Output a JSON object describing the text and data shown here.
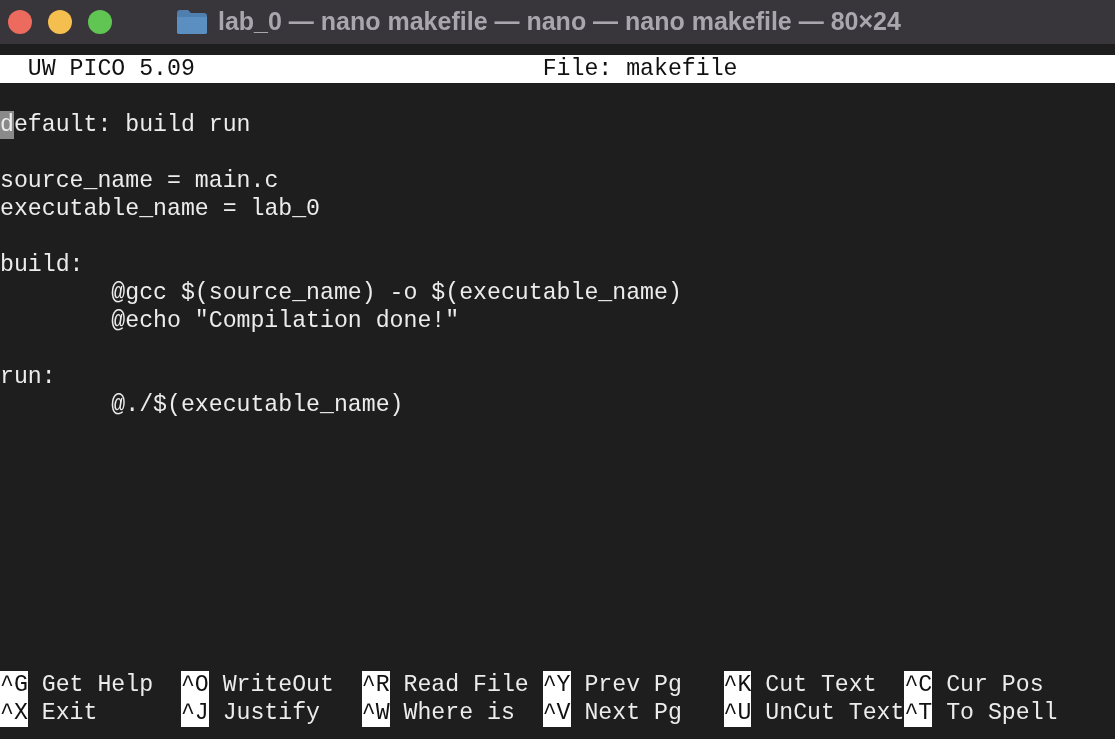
{
  "window": {
    "title": "lab_0 — nano makefile — nano — nano makefile — 80×24"
  },
  "header": {
    "app": "UW PICO 5.09",
    "file": "File: makefile"
  },
  "lines": [
    {
      "kind": "blank"
    },
    {
      "kind": "code",
      "text": "default: build run",
      "indented": false,
      "cursor": true
    },
    {
      "kind": "blank"
    },
    {
      "kind": "code",
      "text": "source_name = main.c",
      "indented": false,
      "cursor": false
    },
    {
      "kind": "code",
      "text": "executable_name = lab_0",
      "indented": false,
      "cursor": false
    },
    {
      "kind": "blank"
    },
    {
      "kind": "code",
      "text": "build:",
      "indented": false,
      "cursor": false
    },
    {
      "kind": "code",
      "text": "@gcc $(source_name) -o $(executable_name)",
      "indented": true,
      "cursor": false
    },
    {
      "kind": "code",
      "text": "@echo \"Compilation done!\"",
      "indented": true,
      "cursor": false
    },
    {
      "kind": "blank"
    },
    {
      "kind": "code",
      "text": "run:",
      "indented": false,
      "cursor": false
    },
    {
      "kind": "code",
      "text": "@./$(executable_name)",
      "indented": true,
      "cursor": false
    }
  ],
  "shortcuts": [
    {
      "key": "^G",
      "label": "Get Help"
    },
    {
      "key": "^O",
      "label": "WriteOut"
    },
    {
      "key": "^R",
      "label": "Read File"
    },
    {
      "key": "^Y",
      "label": "Prev Pg"
    },
    {
      "key": "^K",
      "label": "Cut Text"
    },
    {
      "key": "^C",
      "label": "Cur Pos"
    },
    {
      "key": "^X",
      "label": "Exit"
    },
    {
      "key": "^J",
      "label": "Justify"
    },
    {
      "key": "^W",
      "label": "Where is"
    },
    {
      "key": "^V",
      "label": "Next Pg"
    },
    {
      "key": "^U",
      "label": "UnCut Text"
    },
    {
      "key": "^T",
      "label": "To Spell"
    }
  ]
}
